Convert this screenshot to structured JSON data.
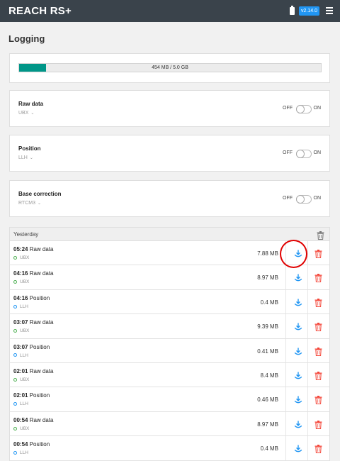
{
  "app": {
    "brand": "REACH RS+",
    "version": "v2.14.0",
    "battery_icon": "battery-icon",
    "menu_icon": "hamburger-menu-icon"
  },
  "page": {
    "title": "Logging"
  },
  "storage": {
    "label": "454 MB / 5.0 GB",
    "used_fraction": 0.0887,
    "fill_color": "#009688"
  },
  "settings": [
    {
      "title": "Raw data",
      "format": "UBX",
      "off_label": "OFF",
      "on_label": "ON",
      "state": "off"
    },
    {
      "title": "Position",
      "format": "LLH",
      "off_label": "OFF",
      "on_label": "ON",
      "state": "off"
    },
    {
      "title": "Base correction",
      "format": "RTCM3",
      "off_label": "OFF",
      "on_label": "ON",
      "state": "off"
    }
  ],
  "logs": {
    "day_label": "Yesterday",
    "entries": [
      {
        "time": "05:24",
        "type": "Raw data",
        "format": "UBX",
        "size": "7.88 MB",
        "dot_color": "#4caf50"
      },
      {
        "time": "04:16",
        "type": "Raw data",
        "format": "UBX",
        "size": "8.97 MB",
        "dot_color": "#4caf50"
      },
      {
        "time": "04:16",
        "type": "Position",
        "format": "LLH",
        "size": "0.4 MB",
        "dot_color": "#2196f3"
      },
      {
        "time": "03:07",
        "type": "Raw data",
        "format": "UBX",
        "size": "9.39 MB",
        "dot_color": "#4caf50"
      },
      {
        "time": "03:07",
        "type": "Position",
        "format": "LLH",
        "size": "0.41 MB",
        "dot_color": "#2196f3"
      },
      {
        "time": "02:01",
        "type": "Raw data",
        "format": "UBX",
        "size": "8.4 MB",
        "dot_color": "#4caf50"
      },
      {
        "time": "02:01",
        "type": "Position",
        "format": "LLH",
        "size": "0.46 MB",
        "dot_color": "#2196f3"
      },
      {
        "time": "00:54",
        "type": "Raw data",
        "format": "UBX",
        "size": "8.97 MB",
        "dot_color": "#4caf50"
      },
      {
        "time": "00:54",
        "type": "Position",
        "format": "LLH",
        "size": "0.4 MB",
        "dot_color": "#2196f3"
      }
    ]
  },
  "colors": {
    "topbar": "#3a434b",
    "accent": "#2196f3",
    "download": "#2196f3",
    "delete": "#f44336",
    "annotation": "#e00000"
  }
}
